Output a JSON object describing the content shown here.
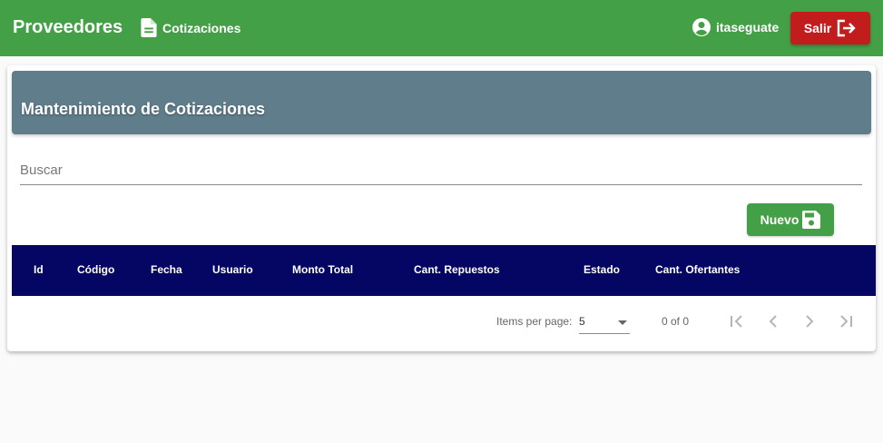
{
  "app": {
    "brand": "Proveedores",
    "nav_link": "Cotizaciones",
    "user": "itaseguate",
    "logout_label": "Salir"
  },
  "page": {
    "title": "Mantenimiento de Cotizaciones",
    "search": {
      "placeholder": "Buscar",
      "value": ""
    },
    "new_button": "Nuevo"
  },
  "table": {
    "columns": [
      "Id",
      "Código",
      "Fecha",
      "Usuario",
      "Monto Total",
      "Cant. Repuestos",
      "Estado",
      "Cant. Ofertantes"
    ],
    "rows": []
  },
  "paginator": {
    "items_per_page_label": "Items per page:",
    "items_per_page": "5",
    "range_label": "0 of 0"
  },
  "colors": {
    "topbar": "#43a047",
    "logout": "#c21c1c",
    "card_header": "#607d8b",
    "table_header": "#050564"
  }
}
